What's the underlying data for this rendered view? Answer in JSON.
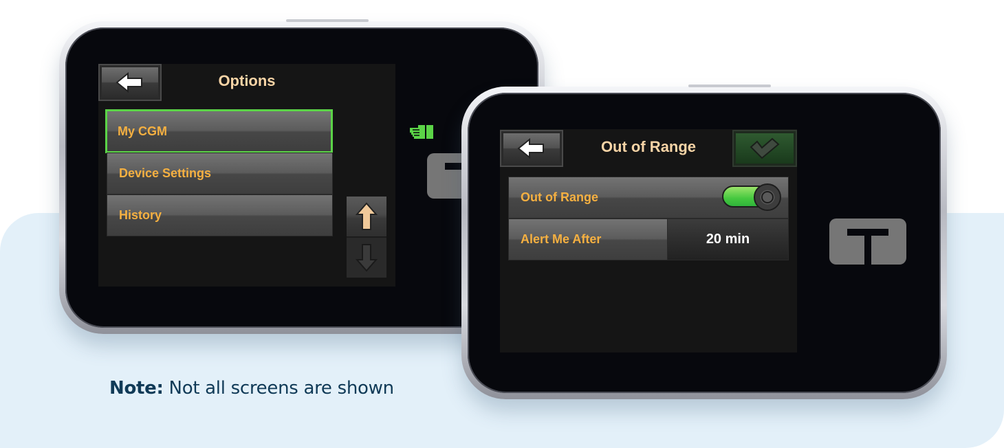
{
  "note": {
    "label": "Note:",
    "text": " Not all screens are shown"
  },
  "colors": {
    "accent_orange": "#f5b041",
    "title_text": "#f7d4a6",
    "selected_border": "#5bd447",
    "toggle_on": "#45c83f",
    "background_panel": "#e3f0f9",
    "note_text": "#103a57"
  },
  "options_screen": {
    "title": "Options",
    "back_icon": "arrow-left-icon",
    "menu_items": [
      {
        "label": "My CGM",
        "selected": true
      },
      {
        "label": "Device Settings",
        "selected": false
      },
      {
        "label": "History",
        "selected": false
      }
    ],
    "scroll_up_icon": "arrow-up-icon",
    "scroll_down_icon": "arrow-down-icon",
    "status_icon": "pointing-hand-icon"
  },
  "out_of_range_screen": {
    "title": "Out of Range",
    "back_icon": "arrow-left-icon",
    "confirm_icon": "checkmark-icon",
    "toggle_row": {
      "label": "Out of Range",
      "enabled": true
    },
    "alert_row": {
      "label": "Alert Me After",
      "value": "20 min"
    }
  }
}
